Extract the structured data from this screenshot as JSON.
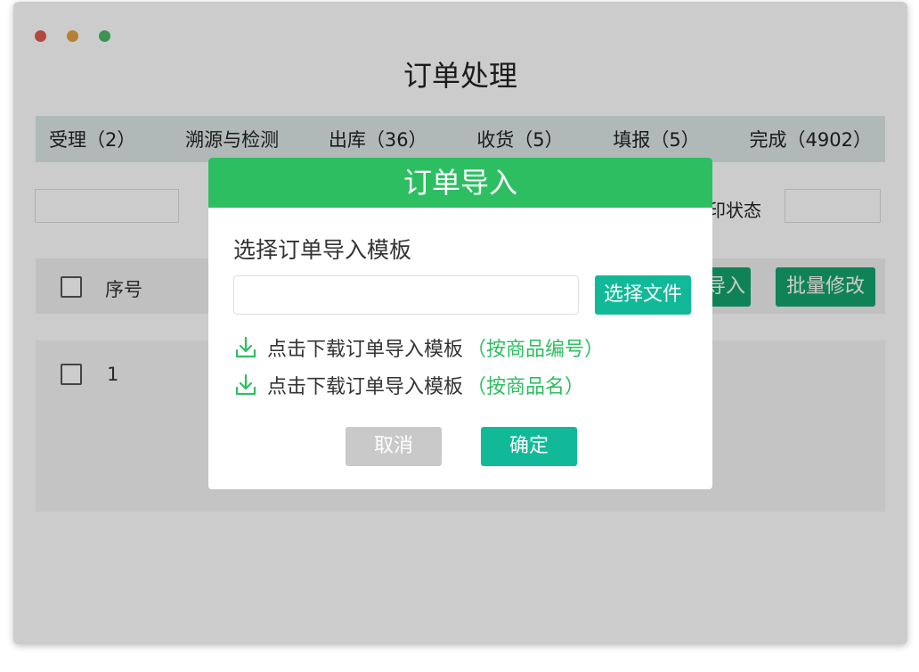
{
  "window": {
    "title": "订单处理",
    "dot_colors": [
      "#e05a4f",
      "#e3a23c",
      "#4cb86a"
    ]
  },
  "tabs": [
    {
      "label": "受理（2）"
    },
    {
      "label": "溯源与检测"
    },
    {
      "label": "出库（36）"
    },
    {
      "label": "收货（5）"
    },
    {
      "label": "填报（5）"
    },
    {
      "label": "完成（4902）"
    }
  ],
  "filters": {
    "status_label_partial": "印状态"
  },
  "table": {
    "header": {
      "index_label": "序号"
    },
    "rows": [
      {
        "index": "1"
      }
    ]
  },
  "toolbar": {
    "import_label_partial": "导入",
    "batch_edit_label": "批量修改"
  },
  "modal": {
    "title": "订单导入",
    "select_template_label": "选择订单导入模板",
    "file_input_value": "",
    "choose_file_label": "选择文件",
    "downloads": [
      {
        "text": "点击下载订单导入模板",
        "note": "（按商品编号）"
      },
      {
        "text": "点击下载订单导入模板",
        "note": "（按商品名）"
      }
    ],
    "cancel_label": "取消",
    "confirm_label": "确定"
  },
  "colors": {
    "accent_green": "#2ebe62",
    "teal": "#12b999",
    "dark_green": "#14a36d"
  }
}
